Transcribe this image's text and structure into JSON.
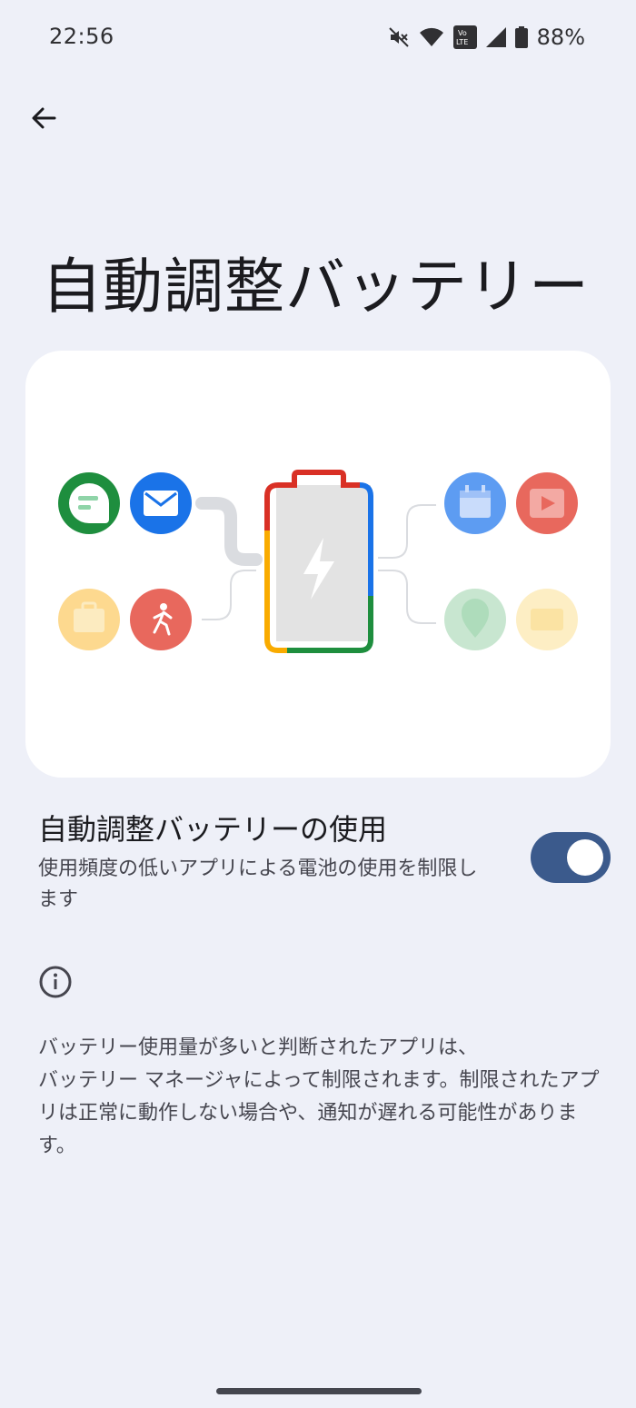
{
  "status_bar": {
    "time": "22:56",
    "battery_percent": "88%",
    "icons": [
      "mute-icon",
      "wifi-icon",
      "volte-icon",
      "cell-signal-icon",
      "battery-icon"
    ],
    "volte_label_top": "Vo",
    "volte_label_bottom": "LTE"
  },
  "toolbar": {
    "back_icon": "arrow-back-icon"
  },
  "page": {
    "title": "自動調整バッテリー"
  },
  "illustration": {
    "left_apps": [
      "chat-icon",
      "email-icon",
      "briefcase-icon",
      "fitness-icon"
    ],
    "right_apps": [
      "calendar-icon",
      "video-icon",
      "maps-icon",
      "photos-icon"
    ],
    "center": "battery-charging-icon"
  },
  "setting": {
    "title": "自動調整バッテリーの使用",
    "summary": "使用頻度の低いアプリによる電池の使用を制限します",
    "enabled": true
  },
  "footer": {
    "info_icon": "info-icon",
    "text_line1": "バッテリー使用量が多いと判断されたアプリは、",
    "text_line2": "バッテリー マネージャによって制限されます。制限されたアプリは正常に動作しない場合や、通知が遅れる可能性があります。"
  },
  "colors": {
    "background": "#eef0f8",
    "card": "#ffffff",
    "toggle_track": "#3b5a8c",
    "google_red": "#d93025",
    "google_blue": "#1a73e8",
    "google_yellow": "#f9ab00",
    "google_green": "#1e8e3e"
  }
}
